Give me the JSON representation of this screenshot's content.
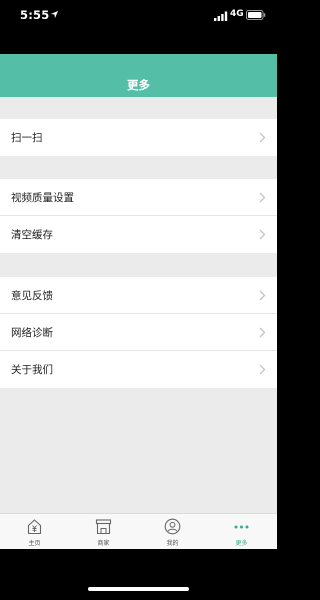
{
  "status_bar": {
    "time": "5:55",
    "network": "4G"
  },
  "header": {
    "title": "更多"
  },
  "menu_groups": [
    {
      "items": [
        {
          "label": "扫一扫"
        }
      ]
    },
    {
      "items": [
        {
          "label": "视频质量设置"
        },
        {
          "label": "清空缓存"
        }
      ]
    },
    {
      "items": [
        {
          "label": "意见反馈"
        },
        {
          "label": "网络诊断"
        },
        {
          "label": "关于我们"
        }
      ]
    }
  ],
  "tab_bar": {
    "tabs": [
      {
        "label": "主页",
        "icon": "home-yen-icon",
        "active": false
      },
      {
        "label": "商家",
        "icon": "store-icon",
        "active": false
      },
      {
        "label": "我的",
        "icon": "user-icon",
        "active": false
      },
      {
        "label": "更多",
        "icon": "more-dots-icon",
        "active": true
      }
    ]
  },
  "colors": {
    "accent": "#55bea6",
    "active_tab": "#3aa88f",
    "background": "#ebebeb"
  }
}
